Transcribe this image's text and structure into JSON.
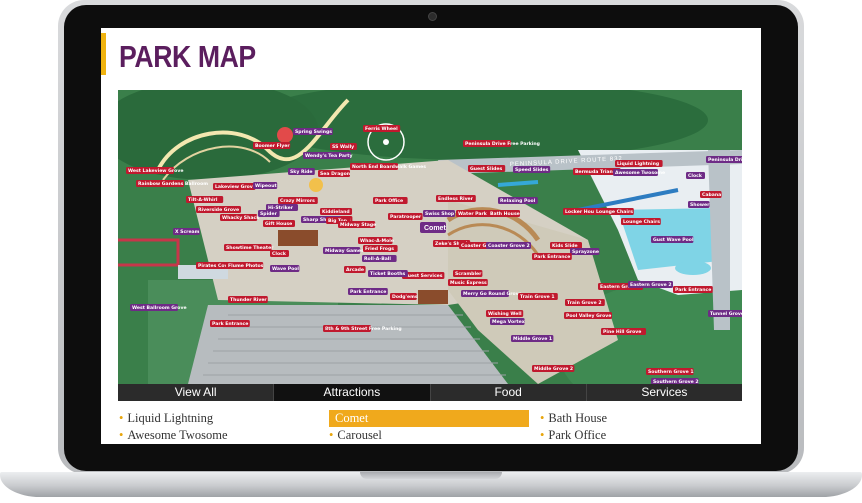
{
  "page": {
    "title": "PARK MAP"
  },
  "colors": {
    "accent": "#f0b30f",
    "title": "#5b1e5e",
    "tab_bar": "#2b2b2b",
    "selected": "#f0a91c",
    "label_red": "#c0192e",
    "label_purple": "#6e2b86"
  },
  "map": {
    "road_label": "PENINSULA DRIVE ROUTE 832",
    "labels": [
      "Spring Swings",
      "Ferris Wheel",
      "Peninsula Drive Free Parking",
      "Peninsula Drive Free Parking",
      "Boomer Flyer",
      "SS Wally",
      "Wendy's Tea Party",
      "North End Boardwalk Games",
      "West Lakeview Grove",
      "Sky Ride",
      "Sea Dragon",
      "Guest Slides",
      "Speed Slides",
      "Bermuda Triangle",
      "Liquid Lightning",
      "Awesome Twosome",
      "Rainbow Gardens Ballroom",
      "Lakeview Grove",
      "Wipeout",
      "Park Office",
      "Endless River",
      "Clock",
      "Cabana",
      "Tilt-A-Whirl",
      "Hi-Striker",
      "Crazy Mirrors",
      "Kiddieland",
      "Shower",
      "Bay Boats",
      "Locker House",
      "Sharp Shooter",
      "Riverside Grove",
      "Whacky Shack",
      "Spider",
      "Gift House",
      "Big Top",
      "Relaxing Pool",
      "Lounge Chairs",
      "Lounge Chairs",
      "Swiss Shop",
      "Water Park Entrance",
      "Bath House",
      "Gust Wave Pool",
      "Midway Stage",
      "Paratrooper",
      "X Scream",
      "Showtime Theater",
      "Clock",
      "Midway Games",
      "Comet",
      "Kids Slide",
      "Sprayzone",
      "Pirates Cove",
      "Flume Photos",
      "Wave Pool",
      "Whac-A-Mole",
      "Fried Frogs",
      "Roll-A-Ball",
      "Zeke's Shack",
      "Coaster Grove 1",
      "Coaster Grove 2",
      "Guest Services",
      "Park Entrance",
      "Park Entrance",
      "Thunder River",
      "Arcade",
      "Ticket Booths",
      "Scrambler",
      "Music Express",
      "Merry Go Round Grove",
      "Train Grove 1",
      "Eastern Grove 1",
      "Eastern Grove 2",
      "Park Entrance",
      "Dodg'ems",
      "West Ballroom Grove",
      "Park Entrance",
      "Wishing Well",
      "Mega Vortex",
      "Train Grove 2",
      "Pool Valley Grove",
      "Tunnel Grove",
      "8th & 9th Street Free Parking",
      "Pine Hill Grove",
      "Middle Grove 1",
      "Middle Grove 2",
      "Southern Grove 1",
      "Southern Grove 2"
    ],
    "comet_badge": "Comet"
  },
  "tabs": [
    {
      "label": "View All",
      "active": false
    },
    {
      "label": "Attractions",
      "active": true
    },
    {
      "label": "Food",
      "active": false
    },
    {
      "label": "Services",
      "active": false
    }
  ],
  "list": {
    "col1": [
      "Liquid Lightning",
      "Awesome Twosome"
    ],
    "col2": [
      "Comet",
      "Carousel"
    ],
    "col3": [
      "Bath House",
      "Park Office"
    ],
    "selected": "Comet"
  }
}
